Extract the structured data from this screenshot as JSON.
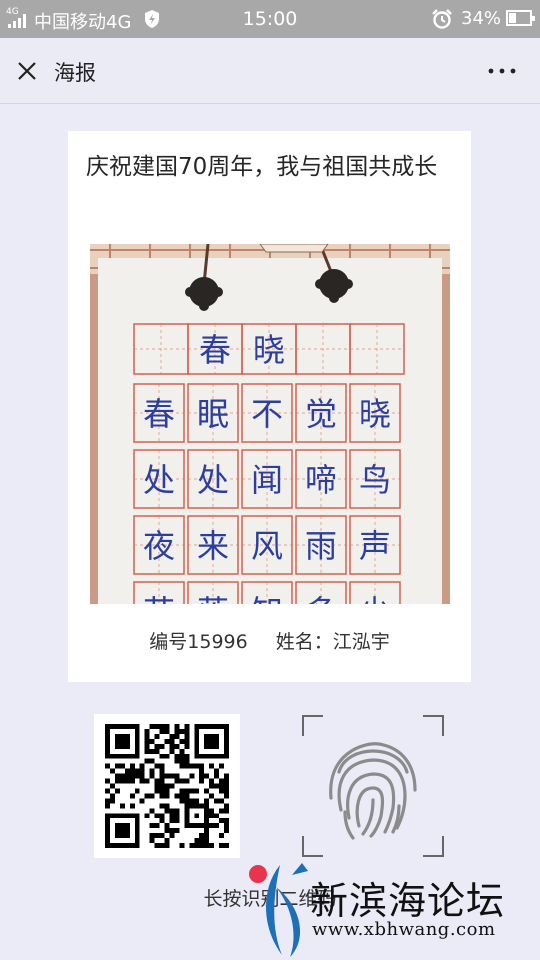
{
  "status_bar": {
    "network_label": "4G",
    "carrier": "中国移动4G",
    "time": "15:00",
    "battery": "34%",
    "battery_level": 0.34,
    "icons": [
      "signal-icon",
      "shield-icon",
      "alarm-icon",
      "battery-icon"
    ]
  },
  "nav": {
    "title": "海报",
    "close_icon": "close-icon",
    "more_icon": "more-icon"
  },
  "poster": {
    "title": "庆祝建国70周年，我与祖国共成长",
    "photo": {
      "heading": "春晓",
      "poem_rows": [
        [
          "春",
          "眠",
          "不",
          "觉",
          "晓"
        ],
        [
          "处",
          "处",
          "闻",
          "啼",
          "鸟"
        ],
        [
          "夜",
          "来",
          "风",
          "雨",
          "声"
        ],
        [
          "花",
          "落",
          "知",
          "多",
          "少"
        ]
      ]
    },
    "number_label": "编号15996",
    "name_label": "姓名：江泓宇"
  },
  "qr_code": {
    "icon": "qr-code-icon"
  },
  "fingerprint": {
    "icon": "fingerprint-icon"
  },
  "hint": "长按识别二维码",
  "watermark": {
    "name": "新滨海论坛",
    "url": "www.xbhwang.com"
  },
  "colors": {
    "status_bar": "#a8a8a8",
    "page_background": "#ebeaf7",
    "card": "#ffffff",
    "grid_red": "#d2634f",
    "ink_blue": "#2c3e9e"
  }
}
